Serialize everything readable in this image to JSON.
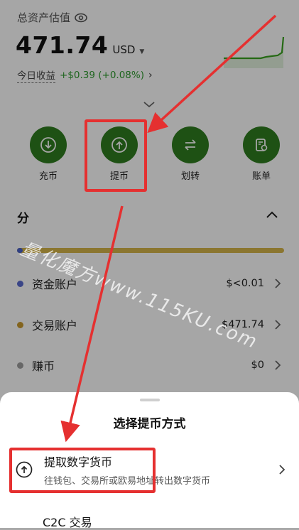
{
  "header": {
    "total_label": "总资产估值",
    "amount": "471.74",
    "currency": "USD",
    "pnl_label": "今日收益",
    "pnl_value": "+$0.39 (+0.08%)"
  },
  "actions": [
    {
      "label": "充币",
      "icon": "deposit-icon"
    },
    {
      "label": "提币",
      "icon": "withdraw-icon"
    },
    {
      "label": "划转",
      "icon": "transfer-icon"
    },
    {
      "label": "账单",
      "icon": "bill-icon"
    }
  ],
  "distribution": {
    "title": "分",
    "accounts": [
      {
        "name": "资金账户",
        "value": "$<0.01",
        "color": "#5a6ad0"
      },
      {
        "name": "交易账户",
        "value": "$471.74",
        "color": "#c99a2e"
      },
      {
        "name": "赚币",
        "value": "$0",
        "color": "#9e9e9e"
      }
    ]
  },
  "watermark": "量化魔方www.115KU.com",
  "sheet": {
    "title": "选择提币方式",
    "option": {
      "title": "提取数字货币",
      "subtitle": "往钱包、交易所或欧易地址转出数字货币"
    },
    "c2c_label": "C2C 交易"
  },
  "colors": {
    "accent_green": "#2f7d1f",
    "gain_green": "#2e9b2e",
    "annotation_red": "#e53030"
  }
}
